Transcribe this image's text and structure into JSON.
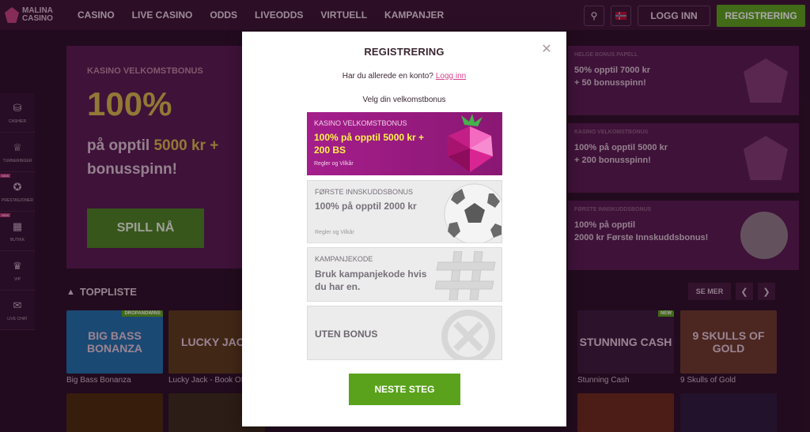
{
  "brand": {
    "line1": "MALINA",
    "line2": "CASINO"
  },
  "nav": [
    "CASINO",
    "LIVE CASINO",
    "ODDS",
    "LIVEODDS",
    "VIRTUELL",
    "KAMPANJER"
  ],
  "header": {
    "login_label": "LOGG INN",
    "register_label": "REGISTRERING"
  },
  "sidebar": {
    "items": [
      {
        "label": "CASHIER",
        "new": ""
      },
      {
        "label": "TURNERINGER",
        "new": ""
      },
      {
        "label": "PRESTASJONER",
        "new": "NEW"
      },
      {
        "label": "BUTIKK",
        "new": "NEW"
      },
      {
        "label": "VIP",
        "new": ""
      },
      {
        "label": "LIVE CHAT",
        "new": ""
      }
    ]
  },
  "hero": {
    "subtitle": "KASINO VELKOMSTBONUS",
    "big": "100%",
    "line2_a": "på opptil ",
    "line2_b": "5000 kr +",
    "line3": "bonusspinn!",
    "button": "SPILL NÅ"
  },
  "promos": [
    {
      "title": "HELGE BONUS PAPELL",
      "text1": "50% opptil 7000 kr",
      "text2": "+ 50 bonusspinn!"
    },
    {
      "title": "KASINO VELKOMSTBONUS",
      "text1": "100% på opptil 5000 kr",
      "text2": "+ 200 bonusspinn!"
    },
    {
      "title": "FØRSTE INNSKUDDSBONUS",
      "text1": "100% på opptil",
      "text2": "2000 kr Første Innskuddsbonus!"
    }
  ],
  "toplist": {
    "label": "TOPPLISTE",
    "more": "SE MER"
  },
  "games": [
    {
      "name": "Big Bass Bonanza",
      "art": "BIG BASS BONANZA",
      "badge": "DROPANDWINS",
      "color": "#1e6ea8"
    },
    {
      "name": "Lucky Jack - Book Of",
      "art": "LUCKY JACK",
      "badge": "",
      "color": "#5a3a1a"
    },
    {
      "name": "Stunning Cash",
      "art": "STUNNING CASH",
      "badge": "NEW",
      "color": "#3a1a3a"
    },
    {
      "name": "9 Skulls of Gold",
      "art": "9 SKULLS OF GOLD",
      "badge": "",
      "color": "#6a3a2a"
    }
  ],
  "modal": {
    "title": "REGISTRERING",
    "account_question": "Har du allerede en konto?",
    "login_link": "Logg inn",
    "choose": "Velg din velkomstbonus",
    "bonuses": [
      {
        "title": "KASINO VELKOMSTBONUS",
        "text": "100% på opptil 5000 kr + 200 BS",
        "terms": "Regler og Vilkår"
      },
      {
        "title": "FØRSTE INNSKUDDSBONUS",
        "text": "100% på opptil 2000 kr",
        "terms": "Regler og Vilkår"
      },
      {
        "title": "KAMPANJEKODE",
        "text": "Bruk kampanjekode hvis du har en.",
        "terms": ""
      },
      {
        "title": "",
        "text": "UTEN BONUS",
        "terms": ""
      }
    ],
    "next_label": "NESTE STEG"
  },
  "colors": {
    "accent_green": "#5aa21b",
    "link_pink": "#d6428b",
    "card_magenta": "#a51e8c",
    "highlight_yellow": "#fff34a"
  }
}
